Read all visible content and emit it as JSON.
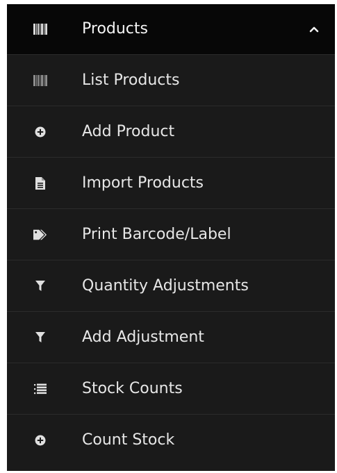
{
  "menu": {
    "header": {
      "label": "Products",
      "icon": "barcode-icon",
      "expanded_indicator": "chevron-up-icon"
    },
    "items": [
      {
        "label": "List Products",
        "icon": "barcode-icon"
      },
      {
        "label": "Add Product",
        "icon": "plus-circle-icon"
      },
      {
        "label": "Import Products",
        "icon": "file-icon"
      },
      {
        "label": "Print Barcode/Label",
        "icon": "tags-icon"
      },
      {
        "label": "Quantity Adjustments",
        "icon": "filter-icon"
      },
      {
        "label": "Add Adjustment",
        "icon": "filter-icon"
      },
      {
        "label": "Stock Counts",
        "icon": "list-ol-icon"
      },
      {
        "label": "Count Stock",
        "icon": "plus-circle-icon"
      }
    ]
  },
  "colors": {
    "header_bg": "#070707",
    "menu_bg": "#1a1a1a",
    "divider": "#2b2b2b",
    "text": "#e7e7e7",
    "icon": "#d8d8d8"
  }
}
